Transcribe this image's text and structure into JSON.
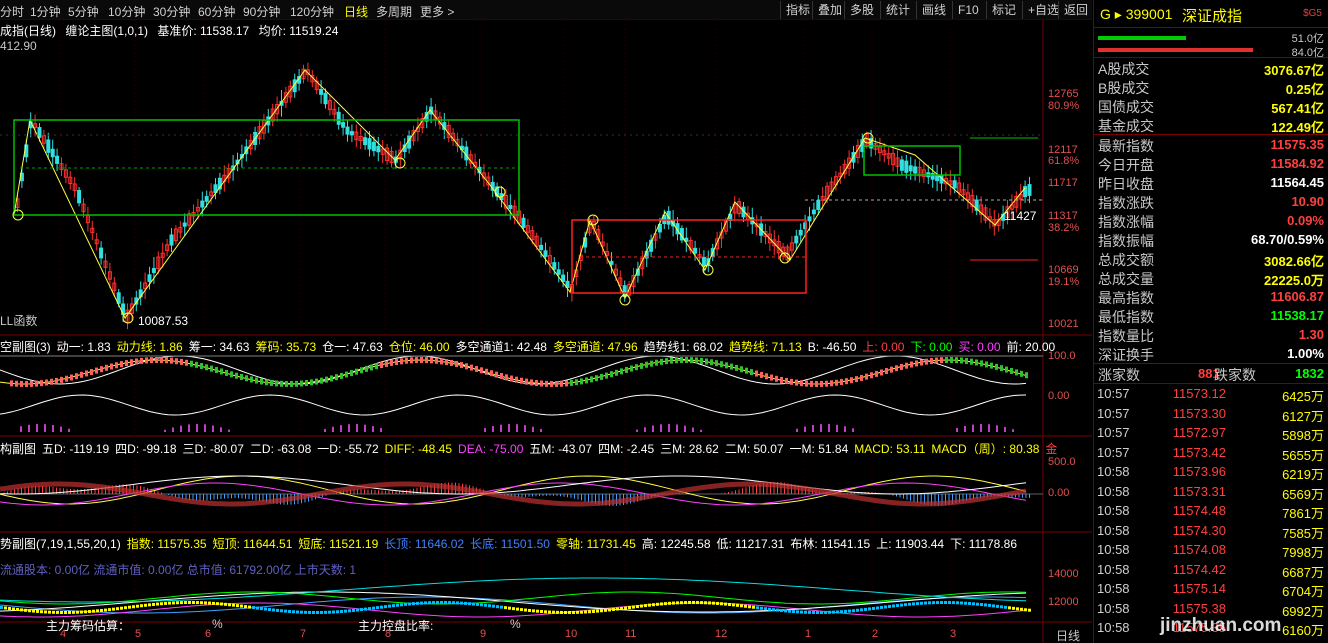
{
  "toolbar": {
    "periods": [
      "分时",
      "1分钟",
      "5分钟",
      "10分钟",
      "30分钟",
      "60分钟",
      "90分钟",
      "120分钟",
      "日线",
      "多周期",
      "更多 >"
    ],
    "active_period": "日线",
    "buttons": [
      "指标",
      "叠加",
      "多股",
      "统计",
      "画线",
      "F10",
      "标记",
      "+自选",
      "返回"
    ]
  },
  "main_chart": {
    "title": "成指(日线)",
    "indicator": "缠论主图(1,0,1)",
    "base_price": "基准价: 11538.17",
    "avg_price": "均价: 11519.24",
    "top_value": "412.90",
    "low_mark": "10087.53",
    "last_mark": "11427",
    "pll": "LL函数",
    "axis": [
      {
        "v": "12765",
        "color": "#e05050"
      },
      {
        "v": "80.9%",
        "color": "#e05050"
      },
      {
        "v": "12117",
        "color": "#e05050"
      },
      {
        "v": "61.8%",
        "color": "#e05050"
      },
      {
        "v": "11717",
        "color": "#e05050"
      },
      {
        "v": "11317",
        "color": "#e05050"
      },
      {
        "v": "38.2%",
        "color": "#e05050"
      },
      {
        "v": "10669",
        "color": "#e05050"
      },
      {
        "v": "19.1%",
        "color": "#e05050"
      },
      {
        "v": "10021",
        "color": "#e05050"
      }
    ]
  },
  "sub1": {
    "title": "空副图(3)",
    "fields": [
      {
        "t": "动一: 1.83",
        "c": "#ffffff"
      },
      {
        "t": "动力线: 1.86",
        "c": "#ffff00"
      },
      {
        "t": "筹一: 34.63",
        "c": "#ffffff"
      },
      {
        "t": "筹码: 35.73",
        "c": "#ffff00"
      },
      {
        "t": "仓一: 47.63",
        "c": "#ffffff"
      },
      {
        "t": "仓位: 46.00",
        "c": "#ffff00"
      },
      {
        "t": "多空通道1: 42.48",
        "c": "#ffffff"
      },
      {
        "t": "多空通道: 47.96",
        "c": "#ffff00"
      },
      {
        "t": "趋势线1: 68.02",
        "c": "#ffffff"
      },
      {
        "t": "趋势线: 71.13",
        "c": "#ffff00"
      },
      {
        "t": "B: -46.50",
        "c": "#ffffff"
      },
      {
        "t": "上: 0.00",
        "c": "#ff4040"
      },
      {
        "t": "下: 0.00",
        "c": "#00ff00"
      },
      {
        "t": "买: 0.00",
        "c": "#ff40ff"
      },
      {
        "t": "前: 20.00",
        "c": "#ffffff"
      }
    ],
    "axis": [
      "100.0",
      "0.00"
    ]
  },
  "sub2": {
    "title": "构副图",
    "fields": [
      {
        "t": "五D: -119.19",
        "c": "#ffffff"
      },
      {
        "t": "四D: -99.18",
        "c": "#ffffff"
      },
      {
        "t": "三D: -80.07",
        "c": "#ffffff"
      },
      {
        "t": "二D: -63.08",
        "c": "#ffffff"
      },
      {
        "t": "一D: -55.72",
        "c": "#ffffff"
      },
      {
        "t": "DIFF: -48.45",
        "c": "#ffff00"
      },
      {
        "t": "DEA: -75.00",
        "c": "#ff40ff"
      },
      {
        "t": "五M: -43.07",
        "c": "#ffffff"
      },
      {
        "t": "四M: -2.45",
        "c": "#ffffff"
      },
      {
        "t": "三M: 28.62",
        "c": "#ffffff"
      },
      {
        "t": "二M: 50.07",
        "c": "#ffffff"
      },
      {
        "t": "一M: 51.84",
        "c": "#ffffff"
      },
      {
        "t": "MACD: 53.11",
        "c": "#ffff00"
      },
      {
        "t": "MACD（周）: 80.38",
        "c": "#ffff00"
      },
      {
        "t": "金",
        "c": "#ff4040"
      }
    ],
    "axis": [
      "500.0",
      "0.00"
    ]
  },
  "sub3": {
    "title": "势副图(7,19,1,55,20,1)",
    "fields": [
      {
        "t": "指数: 11575.35",
        "c": "#ffff00"
      },
      {
        "t": "短顶: 11644.51",
        "c": "#ffff00"
      },
      {
        "t": "短底: 11521.19",
        "c": "#ffff00"
      },
      {
        "t": "长顶: 11646.02",
        "c": "#4080ff"
      },
      {
        "t": "长底: 11501.50",
        "c": "#4080ff"
      },
      {
        "t": "零轴: 11731.45",
        "c": "#ffff00"
      },
      {
        "t": "高: 12245.58",
        "c": "#ffffff"
      },
      {
        "t": "低: 11217.31",
        "c": "#ffffff"
      },
      {
        "t": "布林: 11541.15",
        "c": "#ffffff"
      },
      {
        "t": "上: 11903.44",
        "c": "#ffffff"
      },
      {
        "t": "下: 11178.86",
        "c": "#ffffff"
      }
    ],
    "overlay_line": "流通股本: 0.00亿 流通市值: 0.00亿 总市值: 61792.00亿 上市天数: 1",
    "bottom_left": "主力筹码估算：",
    "bottom_mid": "主力控盘比率:",
    "pct": "%",
    "axis": [
      "14000",
      "12000"
    ]
  },
  "x_axis": [
    "4",
    "5",
    "6",
    "7",
    "8",
    "9",
    "10",
    "11",
    "12",
    "1",
    "2",
    "3"
  ],
  "x_unit": "日线",
  "panel": {
    "code": "399001",
    "name": "深证成指",
    "badge": "$G5",
    "bar_top": "51.0亿",
    "bar_bottom": "84.0亿",
    "stats1": [
      {
        "l": "A股成交",
        "v": "3076.67亿",
        "c": "#ffff00"
      },
      {
        "l": "B股成交",
        "v": "0.25亿",
        "c": "#ffff00"
      },
      {
        "l": "国债成交",
        "v": "567.41亿",
        "c": "#ffff00"
      },
      {
        "l": "基金成交",
        "v": "122.49亿",
        "c": "#ffff00"
      }
    ],
    "stats2": [
      {
        "l": "最新指数",
        "v": "11575.35",
        "c": "#ff4040"
      },
      {
        "l": "今日开盘",
        "v": "11584.92",
        "c": "#ff4040"
      },
      {
        "l": "昨日收盘",
        "v": "11564.45",
        "c": "#ffffff"
      },
      {
        "l": "指数涨跌",
        "v": "10.90",
        "c": "#ff4040"
      },
      {
        "l": "指数涨幅",
        "v": "0.09%",
        "c": "#ff4040"
      },
      {
        "l": "指数振幅",
        "v": "68.70/0.59%",
        "c": "#ffffff"
      },
      {
        "l": "总成交额",
        "v": "3082.66亿",
        "c": "#ffff00"
      },
      {
        "l": "总成交量",
        "v": "22225.0万",
        "c": "#ffff00"
      },
      {
        "l": "最高指数",
        "v": "11606.87",
        "c": "#ff4040"
      },
      {
        "l": "最低指数",
        "v": "11538.17",
        "c": "#00ff00"
      },
      {
        "l": "指数量比",
        "v": "1.30",
        "c": "#ff4040"
      },
      {
        "l": "深证换手",
        "v": "1.00%",
        "c": "#ffffff"
      }
    ],
    "up_label": "涨家数",
    "up_count": "881",
    "down_label": "跌家数",
    "down_count": "1832",
    "ticks": [
      {
        "t": "10:57",
        "p": "11573.12",
        "v": "6425万"
      },
      {
        "t": "10:57",
        "p": "11573.30",
        "v": "6127万"
      },
      {
        "t": "10:57",
        "p": "11572.97",
        "v": "5898万"
      },
      {
        "t": "10:57",
        "p": "11573.42",
        "v": "5655万"
      },
      {
        "t": "10:58",
        "p": "11573.96",
        "v": "6219万"
      },
      {
        "t": "10:58",
        "p": "11573.31",
        "v": "6569万"
      },
      {
        "t": "10:58",
        "p": "11574.48",
        "v": "7861万"
      },
      {
        "t": "10:58",
        "p": "11574.30",
        "v": "7585万"
      },
      {
        "t": "10:58",
        "p": "11574.08",
        "v": "7998万"
      },
      {
        "t": "10:58",
        "p": "11574.42",
        "v": "6687万"
      },
      {
        "t": "10:58",
        "p": "11575.14",
        "v": "6704万"
      },
      {
        "t": "10:58",
        "p": "11575.38",
        "v": "6992万"
      },
      {
        "t": "10:58",
        "p": "11575.35",
        "v": "6160万"
      }
    ]
  },
  "watermark": "jinzhuan.com"
}
